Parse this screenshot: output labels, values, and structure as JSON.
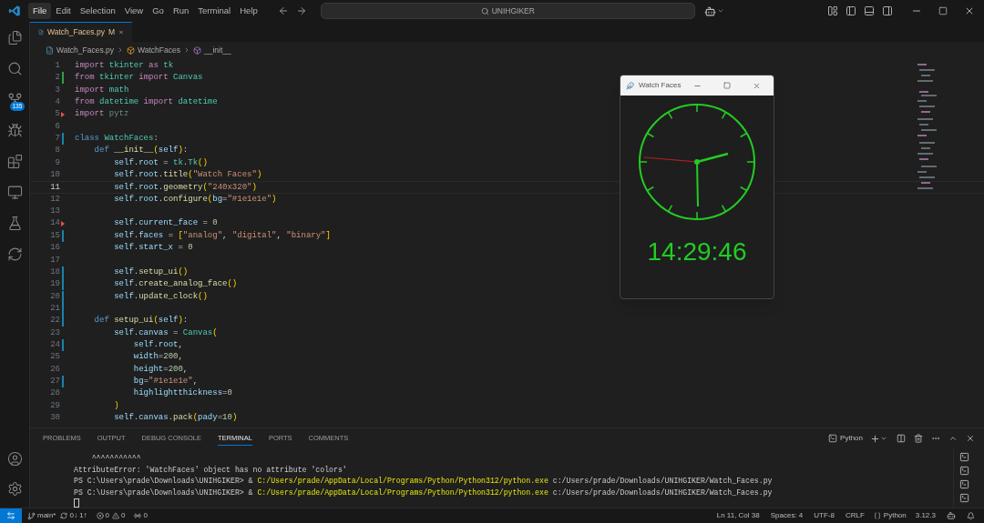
{
  "menu": [
    {
      "label": "File",
      "selected": true
    },
    {
      "label": "Edit",
      "selected": false
    },
    {
      "label": "Selection",
      "selected": false
    },
    {
      "label": "View",
      "selected": false
    },
    {
      "label": "Go",
      "selected": false
    },
    {
      "label": "Run",
      "selected": false
    },
    {
      "label": "Terminal",
      "selected": false
    },
    {
      "label": "Help",
      "selected": false
    }
  ],
  "search": {
    "value": "UNIHGIKER"
  },
  "activity_bar": {
    "items": [
      {
        "kind": "files",
        "selected": false
      },
      {
        "kind": "search",
        "selected": false
      },
      {
        "kind": "source-control",
        "selected": false,
        "badge": "135"
      },
      {
        "kind": "run",
        "selected": false
      },
      {
        "kind": "extensions",
        "selected": false
      },
      {
        "kind": "remote",
        "selected": false
      },
      {
        "kind": "testing",
        "selected": false
      },
      {
        "kind": "g",
        "selected": false
      }
    ]
  },
  "editor_tab": {
    "label": "Watch_Faces.py",
    "status": "M"
  },
  "breadcrumbs": [
    {
      "kind": "file",
      "label": "Watch_Faces.py"
    },
    {
      "kind": "class",
      "label": "WatchFaces"
    },
    {
      "kind": "method",
      "label": "__init__"
    }
  ],
  "code": [
    {
      "n": "1",
      "current": false,
      "tokens": [
        {
          "kind": "kw",
          "text": "import"
        },
        {
          "kind": "cls",
          "text": " tkinter"
        },
        {
          "kind": "kw",
          "text": " as"
        },
        {
          "kind": "cls",
          "text": " tk"
        }
      ]
    },
    {
      "n": "2",
      "current": false,
      "marker": {
        "kind": "added"
      },
      "tokens": [
        {
          "kind": "kw",
          "text": "from"
        },
        {
          "kind": "cls",
          "text": " tkinter"
        },
        {
          "kind": "kw",
          "text": " import"
        },
        {
          "kind": "cls",
          "text": " Canvas"
        }
      ]
    },
    {
      "n": "3",
      "current": false,
      "tokens": [
        {
          "kind": "kw",
          "text": "import"
        },
        {
          "kind": "cls",
          "text": " math"
        }
      ]
    },
    {
      "n": "4",
      "current": false,
      "tokens": [
        {
          "kind": "kw",
          "text": "from"
        },
        {
          "kind": "cls",
          "text": " datetime"
        },
        {
          "kind": "kw",
          "text": " import"
        },
        {
          "kind": "cls",
          "text": " datetime"
        }
      ]
    },
    {
      "n": "5",
      "current": false,
      "marker": {
        "kind": "deleted"
      },
      "tokens": [
        {
          "kind": "kw",
          "text": "import"
        },
        {
          "kind": "dim",
          "text": " pytz"
        }
      ]
    },
    {
      "n": "6",
      "current": false
    },
    {
      "n": "7",
      "current": false,
      "marker": {
        "kind": "modified"
      },
      "tokens": [
        {
          "kind": "def",
          "text": "class"
        },
        {
          "kind": "cls",
          "text": " WatchFaces"
        },
        {
          "kind": "p",
          "text": ":"
        }
      ]
    },
    {
      "n": "8",
      "current": false,
      "tokens": [
        {
          "kind": "def",
          "text": "    def"
        },
        {
          "kind": "fn",
          "text": " __init__"
        },
        {
          "kind": "br",
          "text": "("
        },
        {
          "kind": "var",
          "text": "self"
        },
        {
          "kind": "br",
          "text": ")"
        },
        {
          "kind": "p",
          "text": ":"
        }
      ]
    },
    {
      "n": "9",
      "current": false,
      "tokens": [
        {
          "kind": "var",
          "text": "        self"
        },
        {
          "kind": "p",
          "text": "."
        },
        {
          "kind": "var",
          "text": "root"
        },
        {
          "kind": "p",
          "text": " = "
        },
        {
          "kind": "cls",
          "text": "tk"
        },
        {
          "kind": "p",
          "text": "."
        },
        {
          "kind": "cls",
          "text": "Tk"
        },
        {
          "kind": "br",
          "text": "()"
        }
      ]
    },
    {
      "n": "10",
      "current": false,
      "tokens": [
        {
          "kind": "var",
          "text": "        self"
        },
        {
          "kind": "p",
          "text": "."
        },
        {
          "kind": "var",
          "text": "root"
        },
        {
          "kind": "p",
          "text": "."
        },
        {
          "kind": "fn",
          "text": "title"
        },
        {
          "kind": "br",
          "text": "("
        },
        {
          "kind": "str",
          "text": "\"Watch Faces\""
        },
        {
          "kind": "br",
          "text": ")"
        }
      ]
    },
    {
      "n": "11",
      "current": true,
      "tokens": [
        {
          "kind": "var",
          "text": "        self"
        },
        {
          "kind": "p",
          "text": "."
        },
        {
          "kind": "var",
          "text": "root"
        },
        {
          "kind": "p",
          "text": "."
        },
        {
          "kind": "fn",
          "text": "geometry"
        },
        {
          "kind": "br",
          "text": "("
        },
        {
          "kind": "str",
          "text": "\"240x320\""
        },
        {
          "kind": "br",
          "text": ")"
        }
      ]
    },
    {
      "n": "12",
      "current": false,
      "tokens": [
        {
          "kind": "var",
          "text": "        self"
        },
        {
          "kind": "p",
          "text": "."
        },
        {
          "kind": "var",
          "text": "root"
        },
        {
          "kind": "p",
          "text": "."
        },
        {
          "kind": "fn",
          "text": "configure"
        },
        {
          "kind": "br",
          "text": "("
        },
        {
          "kind": "var",
          "text": "bg"
        },
        {
          "kind": "p",
          "text": "="
        },
        {
          "kind": "str",
          "text": "\"#1e1e1e\""
        },
        {
          "kind": "br",
          "text": ")"
        }
      ]
    },
    {
      "n": "13",
      "current": false
    },
    {
      "n": "14",
      "current": false,
      "marker": {
        "kind": "deleted"
      },
      "tokens": [
        {
          "kind": "var",
          "text": "        self"
        },
        {
          "kind": "p",
          "text": "."
        },
        {
          "kind": "var",
          "text": "current_face"
        },
        {
          "kind": "p",
          "text": " = "
        },
        {
          "kind": "num",
          "text": "0"
        }
      ]
    },
    {
      "n": "15",
      "current": false,
      "marker": {
        "kind": "modified"
      },
      "tokens": [
        {
          "kind": "var",
          "text": "        self"
        },
        {
          "kind": "p",
          "text": "."
        },
        {
          "kind": "var",
          "text": "faces"
        },
        {
          "kind": "p",
          "text": " = "
        },
        {
          "kind": "br",
          "text": "["
        },
        {
          "kind": "str",
          "text": "\"analog\""
        },
        {
          "kind": "p",
          "text": ", "
        },
        {
          "kind": "str",
          "text": "\"digital\""
        },
        {
          "kind": "p",
          "text": ", "
        },
        {
          "kind": "str",
          "text": "\"binary\""
        },
        {
          "kind": "br",
          "text": "]"
        }
      ]
    },
    {
      "n": "16",
      "current": false,
      "tokens": [
        {
          "kind": "var",
          "text": "        self"
        },
        {
          "kind": "p",
          "text": "."
        },
        {
          "kind": "var",
          "text": "start_x"
        },
        {
          "kind": "p",
          "text": " = "
        },
        {
          "kind": "num",
          "text": "0"
        }
      ]
    },
    {
      "n": "17",
      "current": false
    },
    {
      "n": "18",
      "current": false,
      "marker": {
        "kind": "modified"
      },
      "tokens": [
        {
          "kind": "var",
          "text": "        self"
        },
        {
          "kind": "p",
          "text": "."
        },
        {
          "kind": "fn",
          "text": "setup_ui"
        },
        {
          "kind": "br",
          "text": "()"
        }
      ]
    },
    {
      "n": "19",
      "current": false,
      "marker": {
        "kind": "modified"
      },
      "tokens": [
        {
          "kind": "var",
          "text": "        self"
        },
        {
          "kind": "p",
          "text": "."
        },
        {
          "kind": "fn",
          "text": "create_analog_face"
        },
        {
          "kind": "br",
          "text": "()"
        }
      ]
    },
    {
      "n": "20",
      "current": false,
      "marker": {
        "kind": "modified"
      },
      "tokens": [
        {
          "kind": "var",
          "text": "        self"
        },
        {
          "kind": "p",
          "text": "."
        },
        {
          "kind": "fn",
          "text": "update_clock"
        },
        {
          "kind": "br",
          "text": "()"
        }
      ]
    },
    {
      "n": "21",
      "current": false,
      "marker": {
        "kind": "modified"
      }
    },
    {
      "n": "22",
      "current": false,
      "marker": {
        "kind": "modified"
      },
      "tokens": [
        {
          "kind": "def",
          "text": "    def"
        },
        {
          "kind": "fn",
          "text": " setup_ui"
        },
        {
          "kind": "br",
          "text": "("
        },
        {
          "kind": "var",
          "text": "self"
        },
        {
          "kind": "br",
          "text": ")"
        },
        {
          "kind": "p",
          "text": ":"
        }
      ]
    },
    {
      "n": "23",
      "current": false,
      "tokens": [
        {
          "kind": "var",
          "text": "        self"
        },
        {
          "kind": "p",
          "text": "."
        },
        {
          "kind": "var",
          "text": "canvas"
        },
        {
          "kind": "p",
          "text": " = "
        },
        {
          "kind": "cls",
          "text": "Canvas"
        },
        {
          "kind": "br",
          "text": "("
        }
      ]
    },
    {
      "n": "24",
      "current": false,
      "marker": {
        "kind": "modified"
      },
      "tokens": [
        {
          "kind": "var",
          "text": "            self"
        },
        {
          "kind": "p",
          "text": "."
        },
        {
          "kind": "var",
          "text": "root"
        },
        {
          "kind": "p",
          "text": ","
        }
      ]
    },
    {
      "n": "25",
      "current": false,
      "tokens": [
        {
          "kind": "var",
          "text": "            width"
        },
        {
          "kind": "p",
          "text": "="
        },
        {
          "kind": "num",
          "text": "200"
        },
        {
          "kind": "p",
          "text": ","
        }
      ]
    },
    {
      "n": "26",
      "current": false,
      "tokens": [
        {
          "kind": "var",
          "text": "            height"
        },
        {
          "kind": "p",
          "text": "="
        },
        {
          "kind": "num",
          "text": "200"
        },
        {
          "kind": "p",
          "text": ","
        }
      ]
    },
    {
      "n": "27",
      "current": false,
      "marker": {
        "kind": "modified"
      },
      "tokens": [
        {
          "kind": "var",
          "text": "            bg"
        },
        {
          "kind": "p",
          "text": "="
        },
        {
          "kind": "str",
          "text": "\"#1e1e1e\""
        },
        {
          "kind": "p",
          "text": ","
        }
      ]
    },
    {
      "n": "28",
      "current": false,
      "tokens": [
        {
          "kind": "var",
          "text": "            highlightthickness"
        },
        {
          "kind": "p",
          "text": "="
        },
        {
          "kind": "num",
          "text": "0"
        }
      ]
    },
    {
      "n": "29",
      "current": false,
      "tokens": [
        {
          "kind": "br",
          "text": "        )"
        }
      ]
    },
    {
      "n": "30",
      "current": false,
      "tokens": [
        {
          "kind": "var",
          "text": "        self"
        },
        {
          "kind": "p",
          "text": "."
        },
        {
          "kind": "var",
          "text": "canvas"
        },
        {
          "kind": "p",
          "text": "."
        },
        {
          "kind": "fn",
          "text": "pack"
        },
        {
          "kind": "br",
          "text": "("
        },
        {
          "kind": "var",
          "text": "pady"
        },
        {
          "kind": "p",
          "text": "="
        },
        {
          "kind": "num",
          "text": "10"
        },
        {
          "kind": "br",
          "text": ")"
        }
      ]
    }
  ],
  "tk_window": {
    "title": "Watch Faces",
    "time": "14:29:46"
  },
  "panel": {
    "tabs": [
      {
        "label": "PROBLEMS",
        "selected": false
      },
      {
        "label": "OUTPUT",
        "selected": false
      },
      {
        "label": "DEBUG CONSOLE",
        "selected": false
      },
      {
        "label": "TERMINAL",
        "selected": true
      },
      {
        "label": "PORTS",
        "selected": false
      },
      {
        "label": "COMMENTS",
        "selected": false
      }
    ],
    "terminal_name": "Python",
    "terminal_lines": [
      {
        "tokens": [
          {
            "kind": "p",
            "text": "    ^^^^^^^^^^^"
          }
        ]
      },
      {
        "tokens": [
          {
            "kind": "p",
            "text": "AttributeError: 'WatchFaces' object has no attribute 'colors'"
          }
        ]
      },
      {
        "tokens": [
          {
            "kind": "p",
            "text": "PS C:\\Users\\prade\\Downloads\\UNIHGIKER> & "
          },
          {
            "kind": "path",
            "text": "C:/Users/prade/AppData/Local/Programs/Python/Python312/python.exe"
          },
          {
            "kind": "p",
            "text": " c:/Users/prade/Downloads/UNIHGIKER/Watch_Faces.py"
          }
        ]
      },
      {
        "tokens": [
          {
            "kind": "p",
            "text": "PS C:\\Users\\prade\\Downloads\\UNIHGIKER> & "
          },
          {
            "kind": "path",
            "text": "C:/Users/prade/AppData/Local/Programs/Python/Python312/python.exe"
          },
          {
            "kind": "p",
            "text": " c:/Users/prade/Downloads/UNIHGIKER/Watch_Faces.py"
          }
        ]
      }
    ]
  },
  "status_bar": {
    "branch": "main*",
    "sync": "0↓ 1↑",
    "errors": "0",
    "warnings": "0",
    "ports": "0",
    "position": "Ln 11, Col 38",
    "spaces": "Spaces: 4",
    "encoding": "UTF-8",
    "eol": "CRLF",
    "language": "Python",
    "version": "3.12.3"
  }
}
